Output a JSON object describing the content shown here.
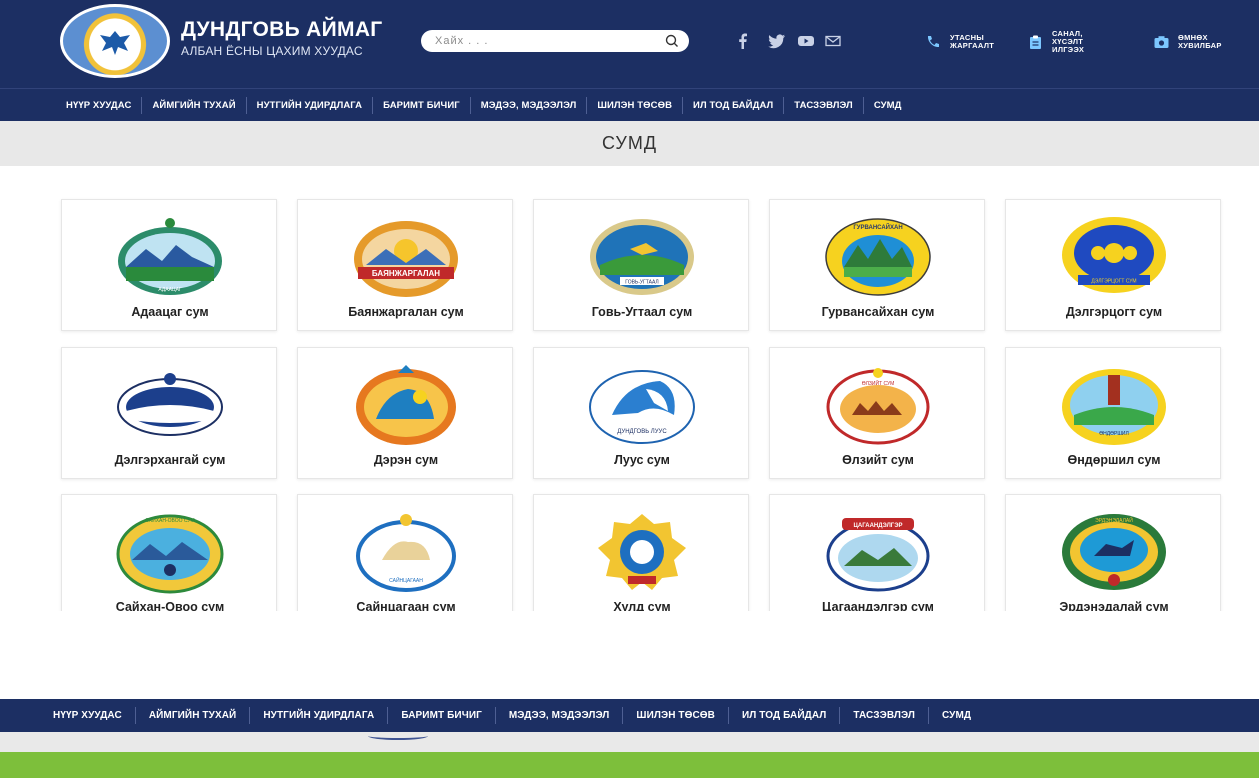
{
  "header": {
    "title": "ДУНДГОВЬ АЙМАГ",
    "subtitle": "АЛБАН ЁСНЫ ЦАХИМ ХУУДАС",
    "search_placeholder": "Хайх . . .",
    "links": [
      {
        "label": "УТАСНЫ ЖАРГААЛТ",
        "icon": "phone-icon"
      },
      {
        "label": "САНАЛ, ХҮСЭЛТ ИЛГЭЭХ",
        "icon": "clipboard-icon"
      },
      {
        "label": "ӨМНӨХ ХУВИЛБАР",
        "icon": "camera-icon"
      }
    ],
    "social_icons": [
      "facebook-icon",
      "twitter-icon",
      "youtube-icon",
      "mail-icon"
    ]
  },
  "nav": {
    "items": [
      "НҮҮР ХУУДАС",
      "АЙМГИЙН ТУХАЙ",
      "НУТГИЙН УДИРДЛАГА",
      "БАРИМТ БИЧИГ",
      "МЭДЭЭ, МЭДЭЭЛЭЛ",
      "ШИЛЭН ТӨСӨВ",
      "ИЛ ТОД БАЙДАЛ",
      "ТАСЗЭВЛЭЛ",
      "СУМД"
    ]
  },
  "page_title": "СУМД",
  "sums": [
    {
      "name": "Адаацаг сум",
      "logo_text": "АДААЦАГ"
    },
    {
      "name": "Баянжаргалан сум",
      "logo_text": "БАЯНЖАРГАЛАН"
    },
    {
      "name": "Говь-Угтаал сум",
      "logo_text": "ГОВЬ-УГТААЛ"
    },
    {
      "name": "Гурвансайхан сум",
      "logo_text": "ГУРВАНСАЙХАН"
    },
    {
      "name": "Дэлгэрцогт сум",
      "logo_text": "ДЭЛГЭРЦОГТ СУМ"
    },
    {
      "name": "Дэлгэрхангай сум",
      "logo_text": ""
    },
    {
      "name": "Дэрэн сум",
      "logo_text": ""
    },
    {
      "name": "Луус сум",
      "logo_text": "ДУНДГОВЬ ЛУУС"
    },
    {
      "name": "Өлзийт сум",
      "logo_text": "ӨЛЗИЙТ СУМ"
    },
    {
      "name": "Өндөршил сум",
      "logo_text": "ӨНДӨРШИЛ"
    },
    {
      "name": "Сайхан-Овоо сум",
      "logo_text": "САЙХАН-ОВОО СУМ"
    },
    {
      "name": "Сайнцагаан сум",
      "logo_text": "САЙНЦАГААН"
    },
    {
      "name": "Хулд сум",
      "logo_text": ""
    },
    {
      "name": "Цагаандэлгэр сум",
      "logo_text": "ЦАГААНДЭЛГЭР"
    },
    {
      "name": "Эрдэнэдалай сум",
      "logo_text": "ЭРДЭНЭДАЛАЙ"
    }
  ],
  "colors": {
    "header_bg": "#1c2f63",
    "band_bg": "#e8e8e8",
    "footer_green": "#7dbf3b"
  }
}
